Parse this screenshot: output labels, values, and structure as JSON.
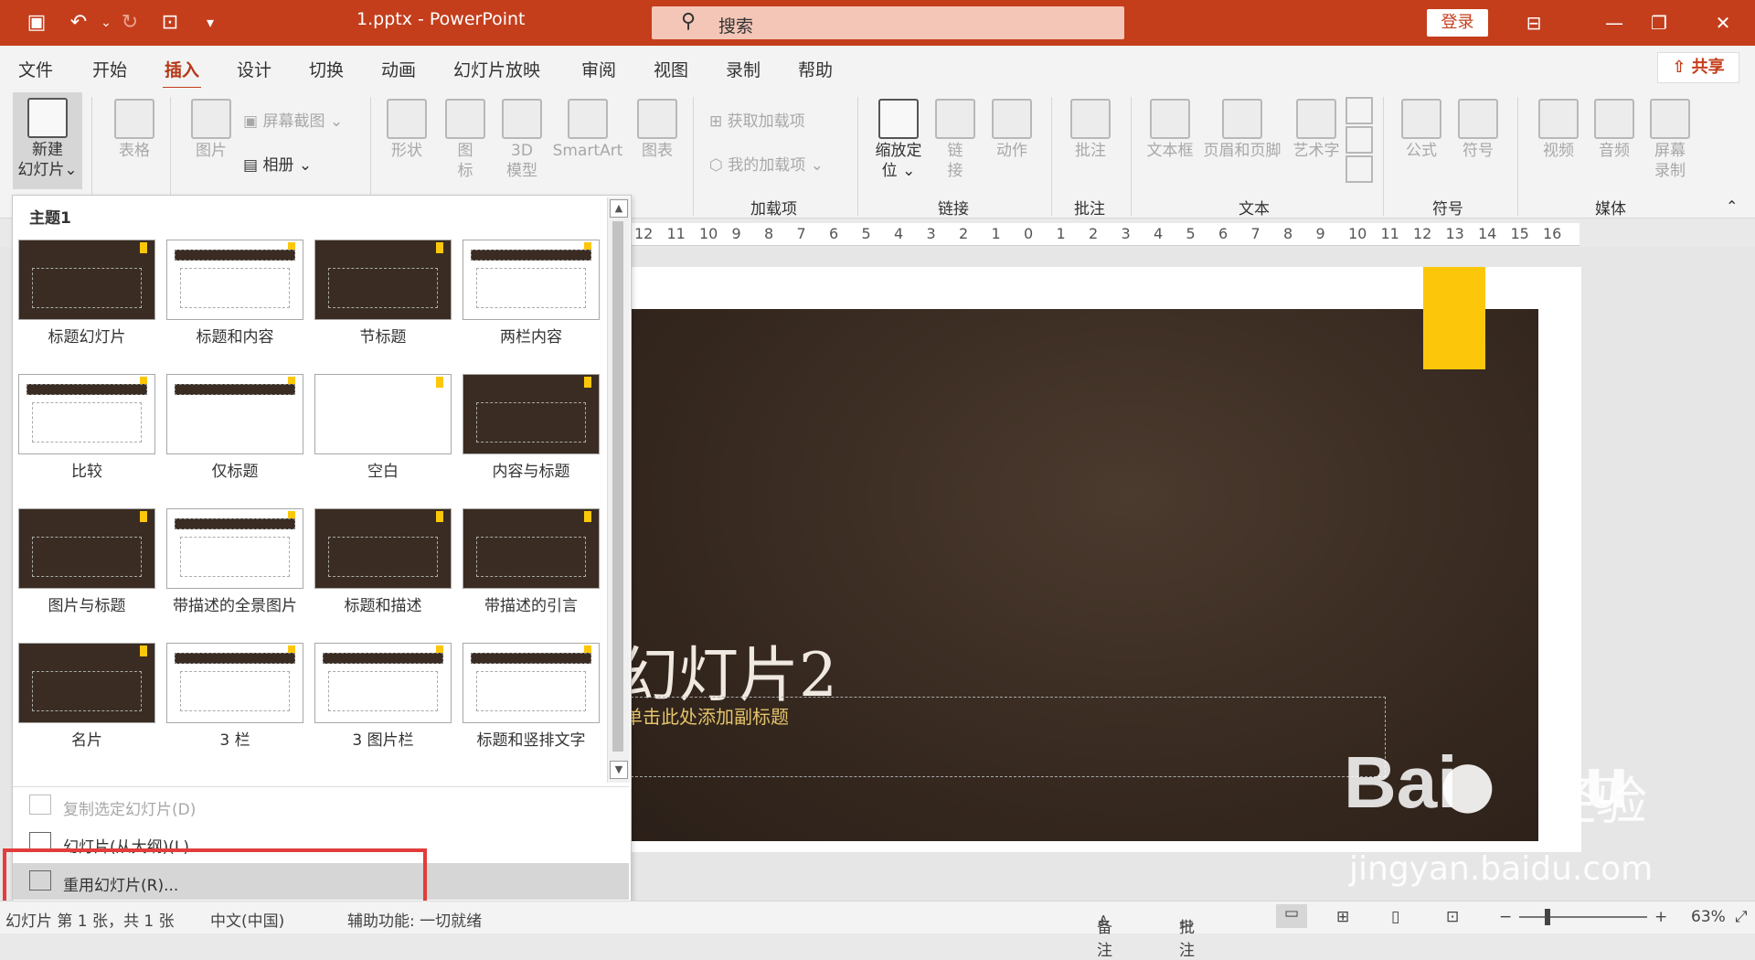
{
  "titlebar": {
    "file_title": "1.pptx  -  PowerPoint",
    "search_placeholder": "搜索",
    "login": "登录"
  },
  "menu": {
    "tabs": [
      "文件",
      "开始",
      "插入",
      "设计",
      "切换",
      "动画",
      "幻灯片放映",
      "审阅",
      "视图",
      "录制",
      "帮助"
    ],
    "active": "插入",
    "share": "共享"
  },
  "ribbon": {
    "new_slide": [
      "新建",
      "幻灯片"
    ],
    "table": "表格",
    "picture": "图片",
    "screenshot": "屏幕截图",
    "album": "相册",
    "shapes": "形状",
    "icons": [
      "图",
      "标"
    ],
    "model3d": [
      "3D",
      "模型"
    ],
    "smartart": "SmartArt",
    "chart": "图表",
    "get_addins": "获取加载项",
    "my_addins": "我的加载项",
    "zoom": [
      "缩放定",
      "位"
    ],
    "link": [
      "链",
      "接"
    ],
    "action": "动作",
    "comment": "批注",
    "textbox": "文本框",
    "header_footer": "页眉和页脚",
    "wordart": "艺术字",
    "equation": "公式",
    "symbol": "符号",
    "video": "视频",
    "audio": "音频",
    "screen_record": [
      "屏幕",
      "录制"
    ],
    "groups": {
      "addins": "加载项",
      "links": "链接",
      "comments": "批注",
      "text": "文本",
      "symbols": "符号",
      "media": "媒体"
    }
  },
  "ruler": [
    "12",
    "11",
    "10",
    "9",
    "8",
    "7",
    "6",
    "5",
    "4",
    "3",
    "2",
    "1",
    "0",
    "1",
    "2",
    "3",
    "4",
    "5",
    "6",
    "7",
    "8",
    "9",
    "10",
    "11",
    "12",
    "13",
    "14",
    "15",
    "16"
  ],
  "slide": {
    "title": "幻灯片2",
    "subtitle": "单击此处添加副标题"
  },
  "gallery": {
    "header": "主题1",
    "layouts": [
      "标题幻灯片",
      "标题和内容",
      "节标题",
      "两栏内容",
      "比较",
      "仅标题",
      "空白",
      "内容与标题",
      "图片与标题",
      "带描述的全景图片",
      "标题和描述",
      "带描述的引言",
      "名片",
      "3 栏",
      "3 图片栏",
      "标题和竖排文字"
    ],
    "menu": [
      {
        "label": "复制选定幻灯片(D)",
        "enabled": false
      },
      {
        "label": "幻灯片(从大纲)(L)...",
        "enabled": true
      },
      {
        "label": "重用幻灯片(R)...",
        "enabled": true,
        "selected": true
      }
    ]
  },
  "status": {
    "slide_info": "幻灯片 第 1 张，共 1 张",
    "language": "中文(中国)",
    "accessibility": "辅助功能: 一切就绪",
    "notes": "备注",
    "comments": "批注",
    "zoom": "63%"
  },
  "watermark": {
    "brand": "Bai",
    "brand2": "du",
    "suffix": "经验",
    "url": "jingyan.baidu.com"
  },
  "colors": {
    "accent": "#c43e1c",
    "slide_bg": "#33261d",
    "yellow": "#fcc70b",
    "highlight": "#e23c3c"
  }
}
